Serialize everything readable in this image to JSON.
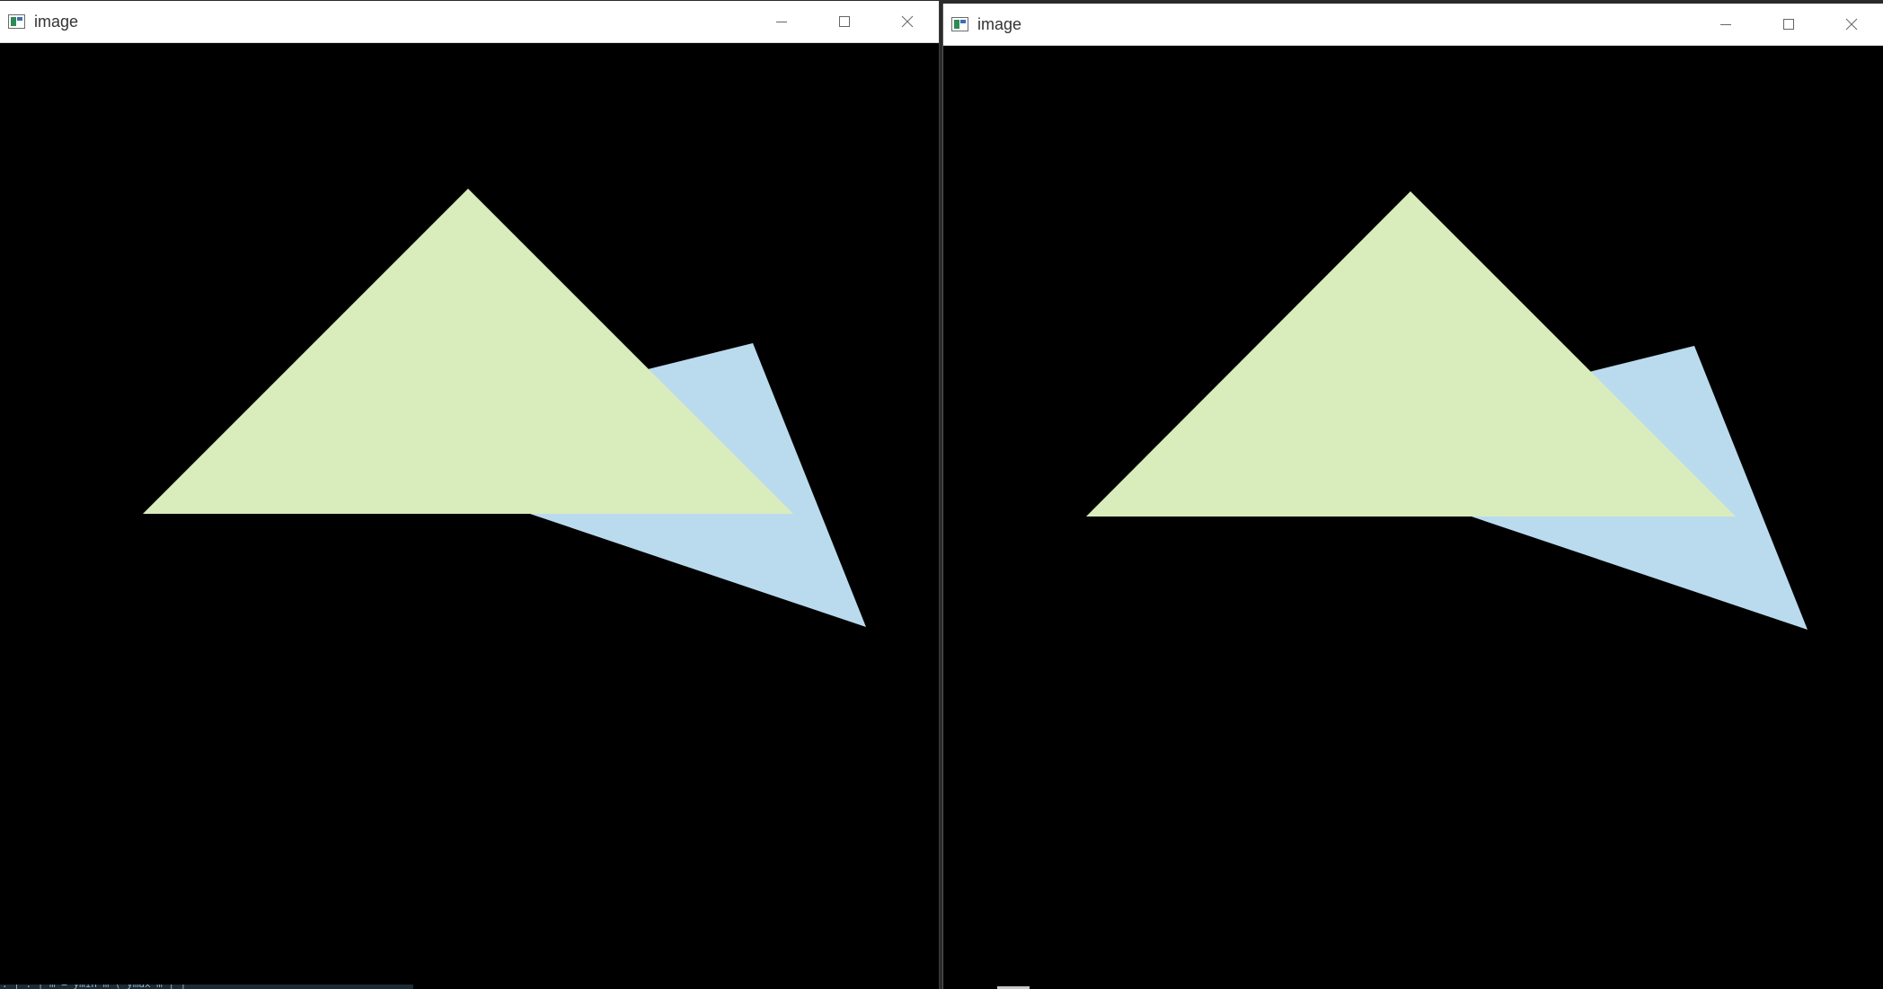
{
  "windows": [
    {
      "title": "image",
      "icon": "opencv-window-icon",
      "controls": [
        "minimize-icon",
        "maximize-icon",
        "close-icon"
      ]
    },
    {
      "title": "image",
      "icon": "opencv-window-icon",
      "controls": [
        "minimize-icon",
        "maximize-icon",
        "close-icon"
      ]
    }
  ],
  "colors": {
    "background": "#000000",
    "triangle_green": "#d9ecbc",
    "triangle_blue": "#badbee",
    "titlebar": "#ffffff"
  }
}
